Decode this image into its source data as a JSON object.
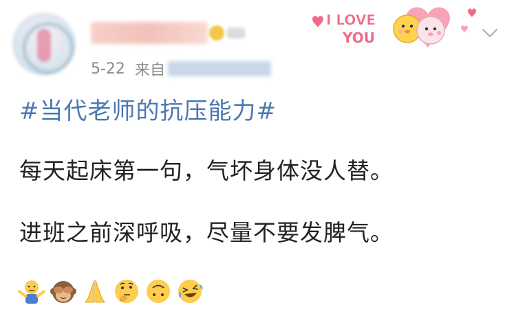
{
  "post": {
    "date": "5-22",
    "source_prefix": "来自",
    "topic": "#当代老师的抗压能力#",
    "line1": "每天起床第一句，气坏身体没人替。",
    "line2": "进班之前深呼吸，尽量不要发脾气。",
    "emojis": [
      "shrug-emoji",
      "see-no-evil-monkey-emoji",
      "folded-hands-emoji",
      "thinking-face-emoji",
      "upside-down-face-emoji",
      "rolling-laughing-emoji"
    ]
  },
  "decoration": {
    "text_line1": "I LOVE",
    "text_line2": "YOU",
    "accent_pink": "#f06a8a",
    "heart_pink": "#f7a4b8"
  },
  "colors": {
    "topic_blue": "#4a78b0",
    "meta_gray": "#8a8a8a",
    "text": "#222222"
  }
}
